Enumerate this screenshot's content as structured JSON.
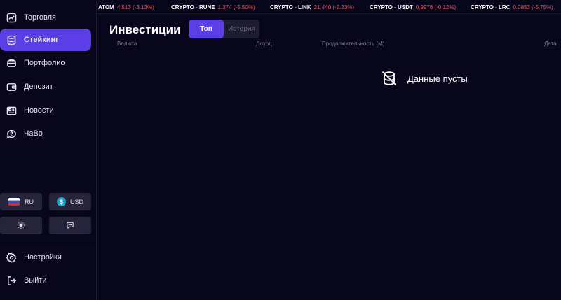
{
  "sidebar": {
    "items": [
      {
        "label": "Торговля",
        "icon": "chart-icon"
      },
      {
        "label": "Стейкинг",
        "icon": "database-icon",
        "active": true
      },
      {
        "label": "Портфолио",
        "icon": "folder-icon"
      },
      {
        "label": "Депозит",
        "icon": "wallet-icon"
      },
      {
        "label": "Новости",
        "icon": "newspaper-icon"
      },
      {
        "label": "ЧаВо",
        "icon": "help-chat-icon"
      }
    ],
    "language": "RU",
    "currency": "USD",
    "settings_label": "Настройки",
    "logout_label": "Выйти"
  },
  "ticker": [
    {
      "symbol": "ATOM",
      "value": "4.513 (-3.13%)"
    },
    {
      "symbol": "CRYPTO - RUNE",
      "value": "1.374 (-5.50%)"
    },
    {
      "symbol": "CRYPTO - LINK",
      "value": "21.440 (-2.23%)"
    },
    {
      "symbol": "CRYPTO - USDT",
      "value": "0.9978 (-0.12%)"
    },
    {
      "symbol": "CRYPTO - LRC",
      "value": "0.0853 (-5.75%)"
    }
  ],
  "main": {
    "title": "Инвестиции",
    "tabs": [
      {
        "label": "Топ",
        "active": true
      },
      {
        "label": "История",
        "active": false
      }
    ],
    "columns": [
      "Валюта",
      "Доход",
      "Продолжительность (М)",
      "Дата"
    ],
    "empty_text": "Данные пусты"
  },
  "colors": {
    "background": "#08061a",
    "accent": "#5b3ee6",
    "negative": "#e25454",
    "pill": "#26243a"
  }
}
